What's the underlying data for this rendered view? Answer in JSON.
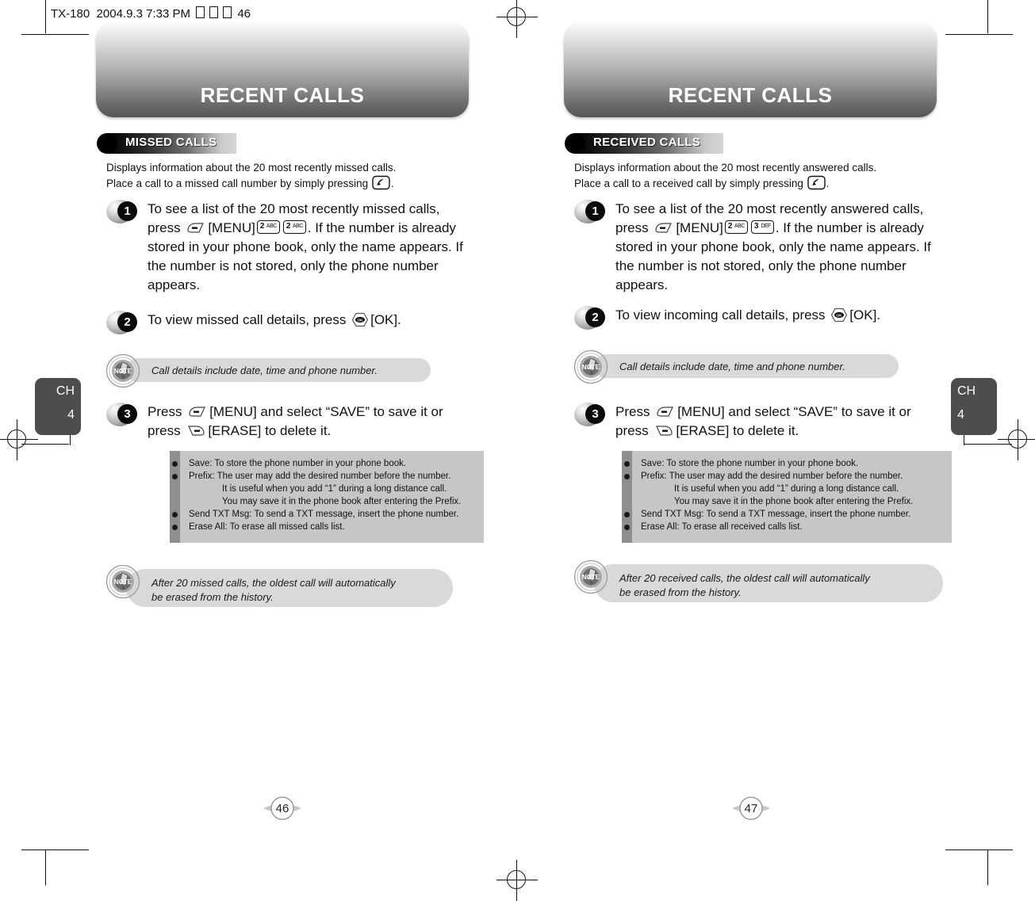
{
  "document": {
    "header_line": {
      "model": "TX-180",
      "date": "2004.9.3",
      "time": "7:33 PM",
      "page_ref": "46"
    }
  },
  "colors": {
    "banner_dark": "#545454",
    "banner_light": "#fbfbfb",
    "section_bar_dark": "#000000",
    "note_pill": "#d9d9d9",
    "gray_box": "#c6c6c6",
    "gray_box_strip": "#8f8f8f",
    "chapter_tab": "#4d4d4d"
  },
  "left_page": {
    "chapter_tab": {
      "ch": "CH",
      "number": "4"
    },
    "banner_title": "RECENT CALLS",
    "section": {
      "label": "MISSED CALLS"
    },
    "intro": {
      "line1": "Displays information about the 20 most recently missed calls.",
      "line2_a": "Place a call to a missed call number by simply pressing",
      "line2_b": "."
    },
    "steps": [
      {
        "number": "1",
        "text_a": "To see a list of the 20 most recently missed calls, press",
        "text_b": "[MENU]",
        "keys": [
          {
            "digit": "2",
            "letters": "ABC"
          },
          {
            "digit": "2",
            "letters": "ABC"
          }
        ],
        "text_c": ". If the number is already stored in your phone book, only the name appears. If the number is not stored, only the phone number appears."
      },
      {
        "number": "2",
        "text_a": "To view missed call details, press",
        "text_b": "[OK]."
      },
      {
        "number": "3",
        "text_a": "Press",
        "text_b": "[MENU] and select “SAVE” to save it or press",
        "text_c": "[ERASE] to delete it."
      }
    ],
    "note_1": "Call details include date, time and phone number.",
    "options_box": [
      {
        "bullet": true,
        "text": "Save: To store the phone number in your phone book."
      },
      {
        "bullet": true,
        "text": "Prefix: The user may add the desired number before the number."
      },
      {
        "bullet": false,
        "text": "It is useful when you add “1” during a long distance call."
      },
      {
        "bullet": false,
        "text": "You may save it in the phone book after entering the Prefix."
      },
      {
        "bullet": true,
        "text": "Send TXT Msg: To send a TXT message, insert the phone number."
      },
      {
        "bullet": true,
        "text": "Erase All: To erase all missed calls list."
      }
    ],
    "note_2_line1": "After 20 missed calls, the oldest call will automatically",
    "note_2_line2": "be erased from the history.",
    "page_number": "46"
  },
  "right_page": {
    "chapter_tab": {
      "ch": "CH",
      "number": "4"
    },
    "banner_title": "RECENT CALLS",
    "section": {
      "label": "RECEIVED CALLS"
    },
    "intro": {
      "line1": "Displays information about the 20 most recently answered calls.",
      "line2_a": "Place a call to a received call by simply pressing",
      "line2_b": "."
    },
    "steps": [
      {
        "number": "1",
        "text_a": "To see a list of the 20 most recently answered calls, press",
        "text_b": "[MENU]",
        "keys": [
          {
            "digit": "2",
            "letters": "ABC"
          },
          {
            "digit": "3",
            "letters": "DEF"
          }
        ],
        "text_c": ". If the number is already stored in your phone book, only the name appears. If the number is not stored, only the phone number appears."
      },
      {
        "number": "2",
        "text_a": "To view incoming call details, press",
        "text_b": "[OK]."
      },
      {
        "number": "3",
        "text_a": "Press",
        "text_b": "[MENU] and select “SAVE” to save it or press",
        "text_c": "[ERASE] to delete it."
      }
    ],
    "note_1": "Call details include date, time and phone number.",
    "options_box": [
      {
        "bullet": true,
        "text": "Save: To store the phone number in your phone book."
      },
      {
        "bullet": true,
        "text": "Prefix: The user may add the desired number before the number."
      },
      {
        "bullet": false,
        "text": "It is useful when you add “1” during a long distance call."
      },
      {
        "bullet": false,
        "text": "You may save it in the phone book after entering the Prefix."
      },
      {
        "bullet": true,
        "text": "Send TXT Msg: To send a TXT message, insert the phone number."
      },
      {
        "bullet": true,
        "text": "Erase All: To erase all received calls list."
      }
    ],
    "note_2_line1": "After 20 received calls, the oldest call will automatically",
    "note_2_line2": "be erased from the history.",
    "page_number": "47"
  },
  "icons": {
    "note_badge_label": "NOTE",
    "ok_key_label": "OK"
  }
}
